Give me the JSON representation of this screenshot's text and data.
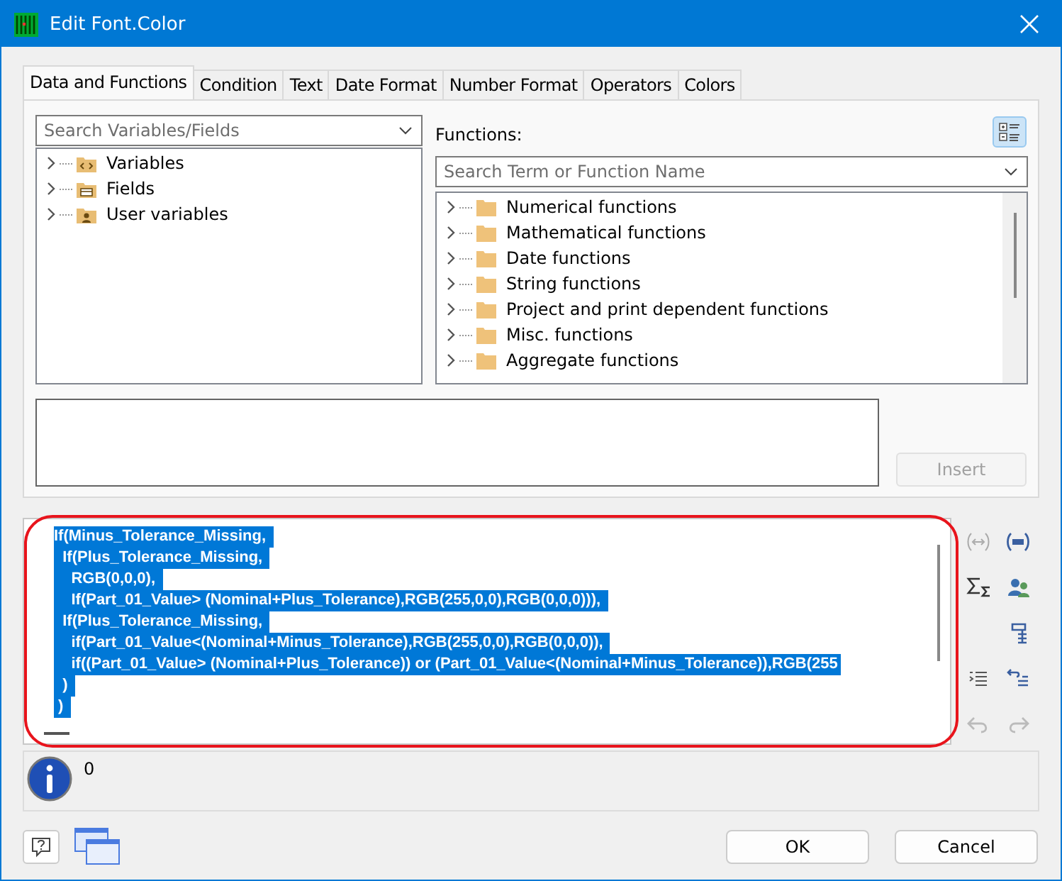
{
  "window": {
    "title": "Edit Font.Color"
  },
  "tabs": [
    {
      "label": "Data and Functions",
      "selected": true
    },
    {
      "label": "Condition",
      "selected": false
    },
    {
      "label": "Text",
      "selected": false
    },
    {
      "label": "Date Format",
      "selected": false
    },
    {
      "label": "Number Format",
      "selected": false
    },
    {
      "label": "Operators",
      "selected": false
    },
    {
      "label": "Colors",
      "selected": false
    }
  ],
  "variables_search": {
    "placeholder": "Search Variables/Fields"
  },
  "variables_tree": [
    {
      "label": "Variables",
      "kind": "variables",
      "expanded": false
    },
    {
      "label": "Fields",
      "kind": "fields",
      "expanded": false
    },
    {
      "label": "User variables",
      "kind": "user",
      "expanded": false
    }
  ],
  "functions_label": "Functions:",
  "functions_search": {
    "placeholder": "Search Term or Function Name"
  },
  "functions_tree": [
    {
      "label": "Numerical functions",
      "kind": "folder",
      "expanded": false
    },
    {
      "label": "Mathematical functions",
      "kind": "folder",
      "expanded": false
    },
    {
      "label": "Date functions",
      "kind": "folder",
      "expanded": false
    },
    {
      "label": "String functions",
      "kind": "folder",
      "expanded": false
    },
    {
      "label": "Project and print dependent functions",
      "kind": "folder",
      "expanded": false
    },
    {
      "label": "Misc. functions",
      "kind": "folder",
      "expanded": false
    },
    {
      "label": "Aggregate functions",
      "kind": "folder",
      "expanded": false
    }
  ],
  "insert_button": {
    "label": "Insert",
    "disabled": true
  },
  "formula": {
    "lines": [
      {
        "text": "If(Minus_Tolerance_Missing, ",
        "selected": true
      },
      {
        "text": "  If(Plus_Tolerance_Missing, ",
        "selected": true
      },
      {
        "text": "    RGB(0,0,0), ",
        "selected": true
      },
      {
        "text": "    If(Part_01_Value> (Nominal+Plus_Tolerance),RGB(255,0,0),RGB(0,0,0))), ",
        "selected": true
      },
      {
        "text": "  If(Plus_Tolerance_Missing, ",
        "selected": true
      },
      {
        "text": "    if(Part_01_Value<(Nominal+Minus_Tolerance),RGB(255,0,0),RGB(0,0,0)), ",
        "selected": true
      },
      {
        "text": "    if((Part_01_Value> (Nominal+Plus_Tolerance)) or (Part_01_Value<(Nominal+Minus_Tolerance)),RGB(255",
        "selected": true
      },
      {
        "text": "  ) ",
        "selected": true
      },
      {
        "text": " ) ",
        "selected": true
      }
    ]
  },
  "info": {
    "text": "0"
  },
  "buttons": [
    {
      "label": "OK"
    },
    {
      "label": "Cancel"
    }
  ]
}
